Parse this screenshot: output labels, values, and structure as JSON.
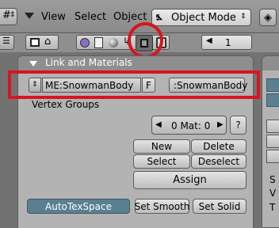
{
  "header": {
    "menu": {
      "view": "View",
      "select": "Select",
      "object": "Object"
    },
    "mode": {
      "label": "Object Mode"
    }
  },
  "toolbar": {
    "layer_value": "1"
  },
  "panel": {
    "title": "Link and Materials",
    "mesh": {
      "name": "ME:SnowmanBody",
      "fake_user": "F",
      "object_name": ":SnowmanBody"
    },
    "vertex_groups_label": "Vertex Groups",
    "material_slot": "0 Mat: 0",
    "help_button": "?",
    "buttons": {
      "new": "New",
      "delete": "Delete",
      "select": "Select",
      "deselect": "Deselect",
      "assign": "Assign",
      "autotexspace": "AutoTexSpace",
      "set_smooth": "Set Smooth",
      "set_solid": "Set Solid"
    }
  },
  "right_peek_text": {
    "s": "S",
    "v": "V",
    "t": "T"
  },
  "colors": {
    "highlight": "#d9141e",
    "panel_bg": "#b3b3b3",
    "active_blue": "#5a7f90"
  }
}
